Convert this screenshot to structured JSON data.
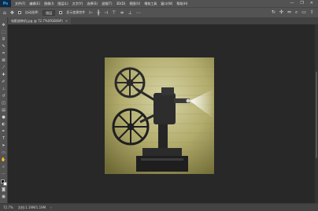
{
  "app": {
    "logo": "Ps"
  },
  "menubar": {
    "items": [
      "文件(F)",
      "编辑(E)",
      "图像(I)",
      "图层(L)",
      "文字(Y)",
      "选择(S)",
      "滤镜(T)",
      "3D(D)",
      "视图(V)",
      "增效工具",
      "窗口(W)",
      "帮助(H)"
    ],
    "window_controls": [
      "—",
      "❐",
      "✕"
    ]
  },
  "options": {
    "auto_select_label": "自动选择:",
    "auto_select_value": "图层",
    "transform_label": "显示变换控件"
  },
  "document": {
    "tab_label": "电影放映机.jpg @ 72.7%(RGB/8#)",
    "close_glyph": "×"
  },
  "status": {
    "zoom": "72.7%",
    "size": "文档:1.19M/1.19M"
  },
  "colors": {
    "chrome": "#535353",
    "canvas": "#282828",
    "accent": "#31a8ff"
  }
}
